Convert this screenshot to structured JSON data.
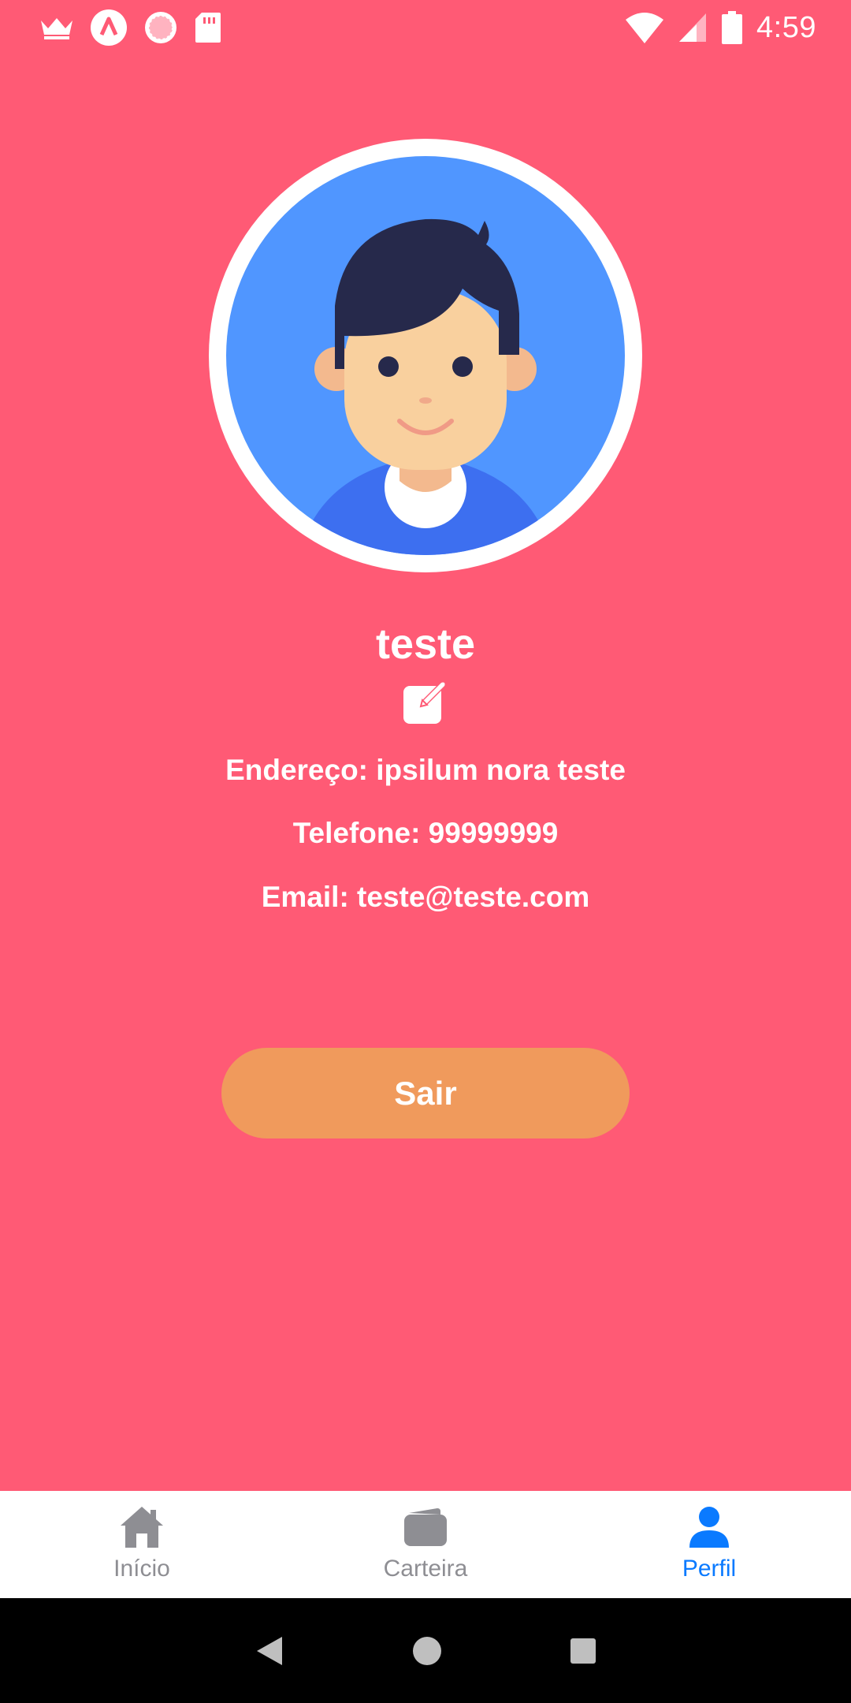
{
  "status_bar": {
    "time": "4:59",
    "icons": [
      "crown-icon",
      "app-a-icon",
      "circle-app-icon",
      "sd-card-icon",
      "wifi-icon",
      "signal-icon",
      "battery-icon"
    ]
  },
  "profile": {
    "name": "teste",
    "address_line": "Endereço: ipsilum nora teste",
    "phone_line": "Telefone: 99999999",
    "email_line": "Email: teste@teste.com"
  },
  "logout_label": "Sair",
  "bottom_nav": {
    "items": [
      {
        "label": "Início",
        "icon": "home-icon",
        "active": false
      },
      {
        "label": "Carteira",
        "icon": "wallet-icon",
        "active": false
      },
      {
        "label": "Perfil",
        "icon": "person-icon",
        "active": true
      }
    ]
  },
  "colors": {
    "background": "#FF5A75",
    "button": "#F09A5C",
    "nav_active": "#0A7AFF",
    "nav_inactive": "#8e8e93",
    "avatar_bg": "#5096FF"
  }
}
